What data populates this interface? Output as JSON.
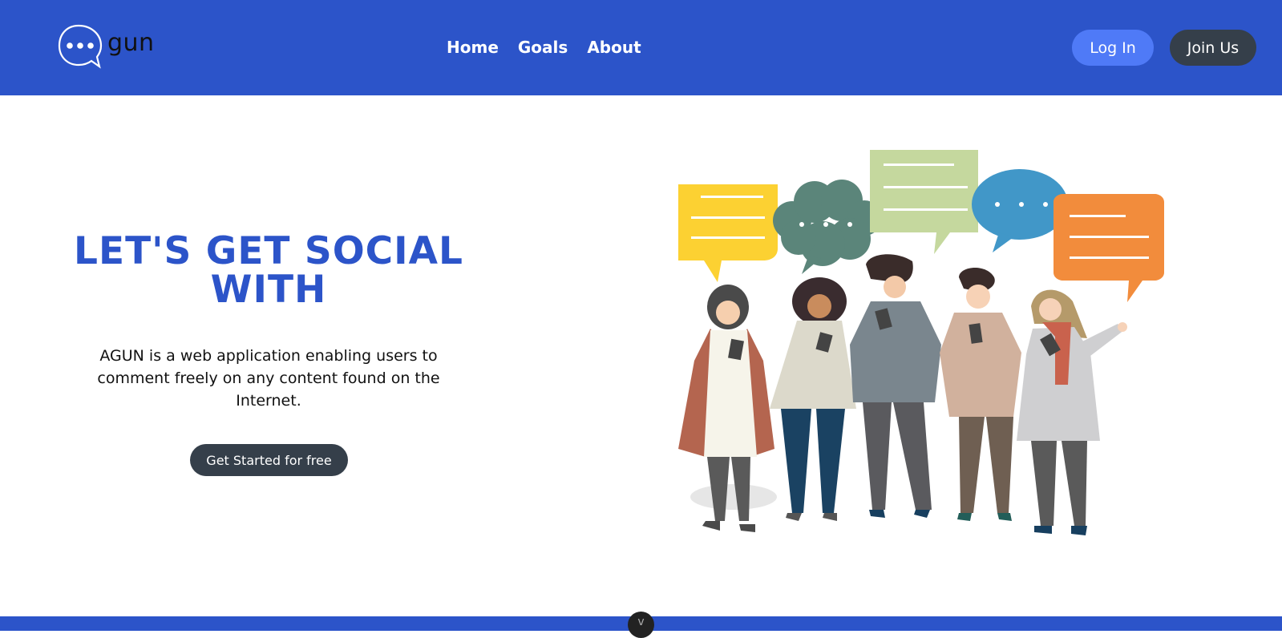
{
  "brand": {
    "name": "gun",
    "color": "#2c54c9"
  },
  "nav": {
    "links": [
      "Home",
      "Goals",
      "About"
    ]
  },
  "auth": {
    "login_label": "Log In",
    "join_label": "Join Us"
  },
  "hero": {
    "title": "LET'S GET SOCIAL WITH",
    "description": "AGUN is a web application enabling users to comment freely on any content found on the Internet.",
    "cta_label": "Get Started for free"
  },
  "scroll_hint": {
    "icon": "chevron-down-icon",
    "glyph": "v"
  },
  "colors": {
    "primary": "#2c54c9",
    "login_button": "#4f7af7",
    "dark_button": "#353f4a"
  }
}
